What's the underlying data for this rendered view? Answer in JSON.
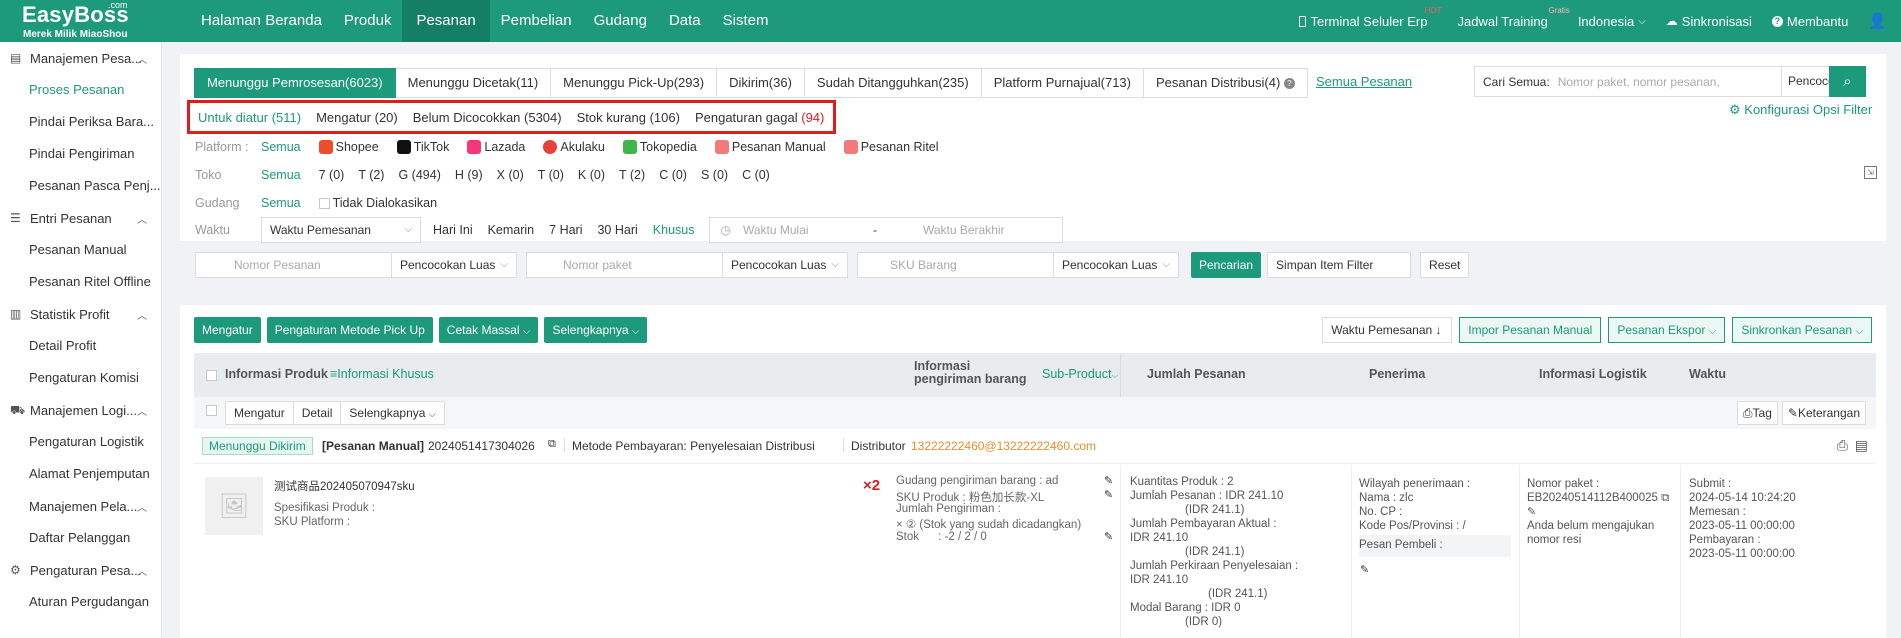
{
  "brand": {
    "com": ".com",
    "name": "EasyBoss",
    "tagline": "Merek Milik MiaoShou"
  },
  "nav": [
    "Halaman Beranda",
    "Produk",
    "Pesanan",
    "Pembelian",
    "Gudang",
    "Data",
    "Sistem"
  ],
  "right_nav": {
    "terminal": "Terminal Seluler Erp",
    "hot": "HOT",
    "training": "Jadwal Training",
    "gratis": "Gratis",
    "language": "Indonesia",
    "sync": "Sinkronisasi",
    "help": "Membantu"
  },
  "sidebar": {
    "g1": "Manajemen Pesa...",
    "g1_items": [
      "Proses Pesanan",
      "Pindai Periksa Bara...",
      "Pindai Pengiriman",
      "Pesanan Pasca Penj..."
    ],
    "g2": "Entri Pesanan",
    "g2_items": [
      "Pesanan Manual",
      "Pesanan Ritel Offline"
    ],
    "g3": "Statistik Profit",
    "g3_items": [
      "Detail Profit",
      "Pengaturan Komisi"
    ],
    "g4": "Manajemen Logi...",
    "g4_items": [
      "Pengaturan Logistik",
      "Alamat Penjemputan"
    ],
    "g5": "Manajemen Pela...",
    "g5_items": [
      "Daftar Pelanggan"
    ],
    "g6": "Pengaturan Pesa...",
    "g6_items": [
      "Aturan Pergudangan"
    ]
  },
  "tabs": [
    "Menunggu Pemrosesan(6023)",
    "Menunggu Dicetak(11)",
    "Menunggu Pick-Up(293)",
    "Dikirim(36)",
    "Sudah Ditangguhkan(235)",
    "Platform Purnajual(713)",
    "Pesanan Distribusi(4)"
  ],
  "all_orders": "Semua Pesanan",
  "search": {
    "label": "Cari Semua:",
    "placeholder": "Nomor paket, nomor pesanan,",
    "mode": "Pencoco"
  },
  "subtabs": {
    "t1": "Untuk diatur (511)",
    "t2": "Mengatur (20)",
    "t3": "Belum Dicocokkan (5304)",
    "t4": "Stok kurang (106)",
    "t5_label": "Pengaturan gagal",
    "t5_count": "(94)"
  },
  "config_filter": "Konfigurasi Opsi Filter",
  "platform": {
    "label": "Platform",
    "items": [
      "Semua",
      "Shopee",
      "TikTok",
      "Lazada",
      "Akulaku",
      "Tokopedia",
      "Pesanan Manual",
      "Pesanan Ritel"
    ],
    "colors": [
      "#ee4d2d",
      "#111111",
      "#f7367a",
      "#e8403a",
      "#42b549",
      "#f27a7a",
      "#f27a7a"
    ]
  },
  "store": {
    "label": "Toko",
    "items": [
      "Semua",
      "7 (0)",
      "T (2)",
      "G (494)",
      "H (9)",
      "X (0)",
      "T (0)",
      "K (0)",
      "T (2)",
      "C (0)",
      "S (0)",
      "C (0)"
    ]
  },
  "warehouse": {
    "label": "Gudang",
    "all": "Semua",
    "unassigned": "Tidak Dialokasikan"
  },
  "time": {
    "label": "Waktu",
    "type": "Waktu Pemesanan",
    "options": [
      "Hari Ini",
      "Kemarin",
      "7 Hari",
      "30 Hari",
      "Khusus"
    ],
    "start": "Waktu Mulai",
    "sep": "-",
    "end": "Waktu Berakhir"
  },
  "filters": {
    "order_no": "Nomor Pesanan",
    "package_no": "Nomor paket",
    "sku": "SKU Barang",
    "match": "Pencocokan Luas",
    "search_btn": "Pencarian",
    "save_filter": "Simpan Item Filter",
    "reset": "Reset"
  },
  "actions": {
    "arrange": "Mengatur",
    "pickup": "Pengaturan Metode Pick Up",
    "print": "Cetak Massal",
    "more": "Selengkapnya",
    "sort": "Waktu Pemesanan",
    "import": "Impor Pesanan Manual",
    "export": "Pesanan Ekspor",
    "sync": "Sinkronkan Pesanan"
  },
  "table_head": {
    "product": "Informasi Produk",
    "special": "Informasi Khusus",
    "shipping": "Informasi pengiriman barang",
    "subproduct": "Sub-Product",
    "amount": "Jumlah Pesanan",
    "receiver": "Penerima",
    "logistics": "Informasi Logistik",
    "time": "Waktu"
  },
  "row_actions": {
    "arrange": "Mengatur",
    "detail": "Detail",
    "more": "Selengkapnya",
    "tag": "Tag",
    "note": "Keterangan"
  },
  "order": {
    "status": "Menunggu Dikirim",
    "type": "[Pesanan Manual]",
    "order_no": "2024051417304026",
    "payment": "Metode Pembayaran: Penyelesaian Distribusi",
    "distributor_label": "Distributor",
    "distributor": "13222222460@13222222460.com",
    "product_name": "测试商品202405070947sku",
    "spec_label": "Spesifikasi Produk :",
    "platform_sku_label": "SKU Platform :",
    "qty_mark": "×2",
    "ship_wh": "Gudang pengiriman barang : ad",
    "sku_line": "SKU Produk : 粉色加长款-XL",
    "ship_qty_label": "Jumlah Pengiriman :",
    "ship_qty": "× ② (Stok yang sudah dicadangkan)",
    "stock": "Stok      : -2 / 2 / 0",
    "amount_lines": [
      "Kuantitas Produk : 2",
      "Jumlah Pesanan : IDR 241.10",
      "(IDR 241.1)",
      "Jumlah Pembayaran Aktual :",
      "IDR 241.10",
      "(IDR 241.1)",
      "Jumlah Perkiraan Penyelesaian :",
      "IDR 241.10",
      "(IDR 241.1)",
      "Modal Barang : IDR 0",
      "(IDR 0)"
    ],
    "receiver_lines": [
      "Wilayah penerimaan :",
      "Nama : zlc",
      "No. CP :",
      "Kode Pos/Provinsi : /"
    ],
    "buyer_msg": "Pesan Pembeli :",
    "logistics_lines": [
      "Nomor paket :",
      "EB20240514112B400025",
      "Anda belum mengajukan",
      "nomor resi"
    ],
    "time_lines": [
      "Submit :",
      "2024-05-14 10:24:20",
      "Memesan :",
      "2023-05-11 00:00:00",
      "Pembayaran :",
      "2023-05-11 00:00:00"
    ]
  }
}
